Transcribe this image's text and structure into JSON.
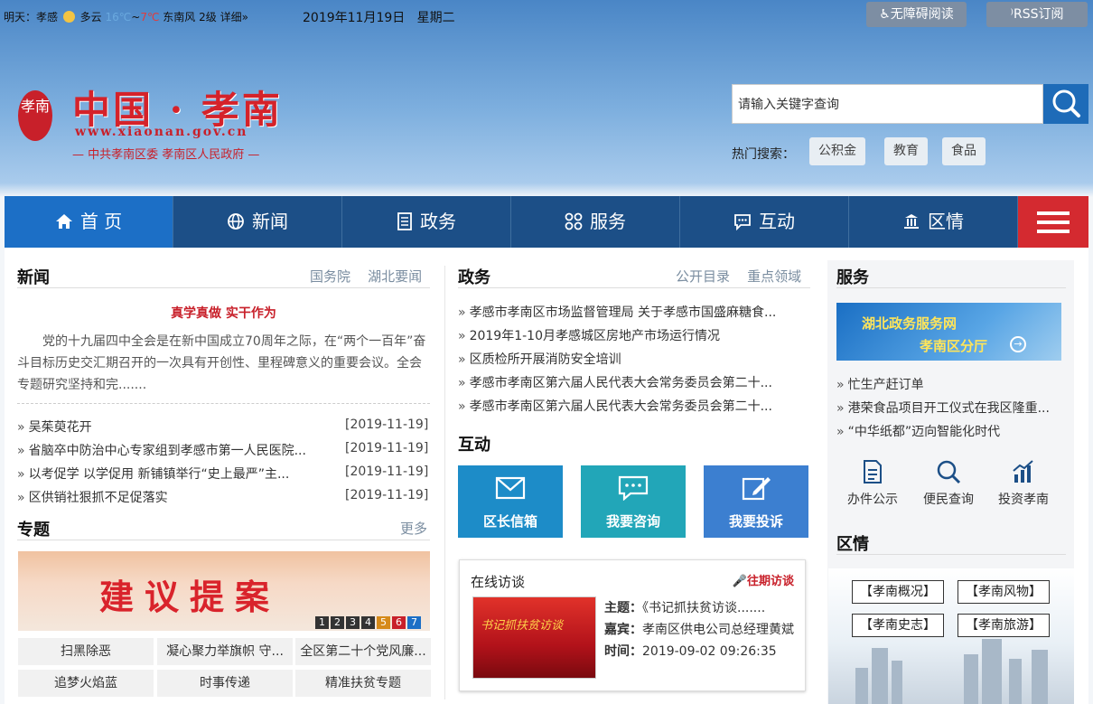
{
  "topbar": {
    "weather_prefix": "明天：孝感",
    "weather_cond": "多云",
    "temp_low": "16℃",
    "temp_sep": "~",
    "temp_high": "7℃",
    "wind": "东南风 2级",
    "detail_link": "详细»",
    "date": "2019年11月19日",
    "weekday": "星期二",
    "access_btn": "无障碍阅读",
    "rss_btn": "RSS订阅"
  },
  "logo": {
    "seal": "孝南",
    "title": "中国 · 孝南",
    "url": "www.xiaonan.gov.cn",
    "subtitle": "— 中共孝南区委   孝南区人民政府 —"
  },
  "search": {
    "value": "请输入关键字查询",
    "hot_label": "热门搜索：",
    "hot_tags": [
      "公积金",
      "教育",
      "食品"
    ]
  },
  "nav": {
    "items": [
      "首 页",
      "新闻",
      "政务",
      "服务",
      "互动",
      "区情"
    ]
  },
  "news": {
    "title": "新闻",
    "links": [
      "国务院",
      "湖北要闻"
    ],
    "headline": "真学真做 实干作为",
    "summary": "党的十九届四中全会是在新中国成立70周年之际，在“两个一百年”奋斗目标历史交汇期召开的一次具有开创性、里程碑意义的重要会议。全会专题研究坚持和完.......",
    "items": [
      {
        "title": "吴茱萸花开",
        "date": "[2019-11-19]"
      },
      {
        "title": "省脑卒中防治中心专家组到孝感市第一人民医院...",
        "date": "[2019-11-19]"
      },
      {
        "title": "以考促学 以学促用 新铺镇举行“史上最严”主...",
        "date": "[2019-11-19]"
      },
      {
        "title": "区供销社狠抓不足促落实",
        "date": "[2019-11-19]"
      }
    ]
  },
  "topics": {
    "title": "专题",
    "more": "更多",
    "banner_text": "建议提案",
    "pager": [
      "1",
      "2",
      "3",
      "4",
      "5",
      "6",
      "7"
    ],
    "items": [
      "扫黑除恶",
      "凝心聚力举旗帜 守...",
      "全区第二十个党风廉...",
      "追梦火焰蓝",
      "时事传递",
      "精准扶贫专题"
    ]
  },
  "gov": {
    "title": "政务",
    "links": [
      "公开目录",
      "重点领域"
    ],
    "items": [
      "孝感市孝南区市场监督管理局 关于孝感市国盛麻糖食...",
      "2019年1-10月孝感城区房地产市场运行情况",
      "区质检所开展消防安全培训",
      "孝感市孝南区第六届人民代表大会常务委员会第二十...",
      "孝感市孝南区第六届人民代表大会常务委员会第二十..."
    ]
  },
  "interact": {
    "title": "互动",
    "tiles": [
      "区长信箱",
      "我要咨询",
      "我要投诉"
    ],
    "tile_colors": [
      "#1d8cc8",
      "#22a6b8",
      "#3c7fd0"
    ],
    "visit": {
      "title": "在线访谈",
      "past_link": "往期访谈",
      "image_text": "书记抓扶贫访谈",
      "topic_label": "主题：",
      "topic": "《书记抓扶贫访谈.......",
      "guest_label": "嘉宾：",
      "guest": "孝南区供电公司总经理黄斌",
      "time_label": "时间：",
      "time": "2019-09-02 09:26:35"
    }
  },
  "service": {
    "title": "服务",
    "banner_l1": "湖北政务服务网",
    "banner_l2": "孝南区分厅",
    "items": [
      "忙生产赶订单",
      "港荣食品项目开工仪式在我区隆重...",
      "“中华纸都”迈向智能化时代"
    ],
    "icons": [
      {
        "label": "办件公示",
        "icon": "document-icon"
      },
      {
        "label": "便民查询",
        "icon": "search-icon"
      },
      {
        "label": "投资孝南",
        "icon": "chart-icon"
      }
    ]
  },
  "area": {
    "title": "区情",
    "buttons": [
      "【孝南概况】",
      "【孝南风物】",
      "【孝南史志】",
      "【孝南旅游】"
    ]
  }
}
